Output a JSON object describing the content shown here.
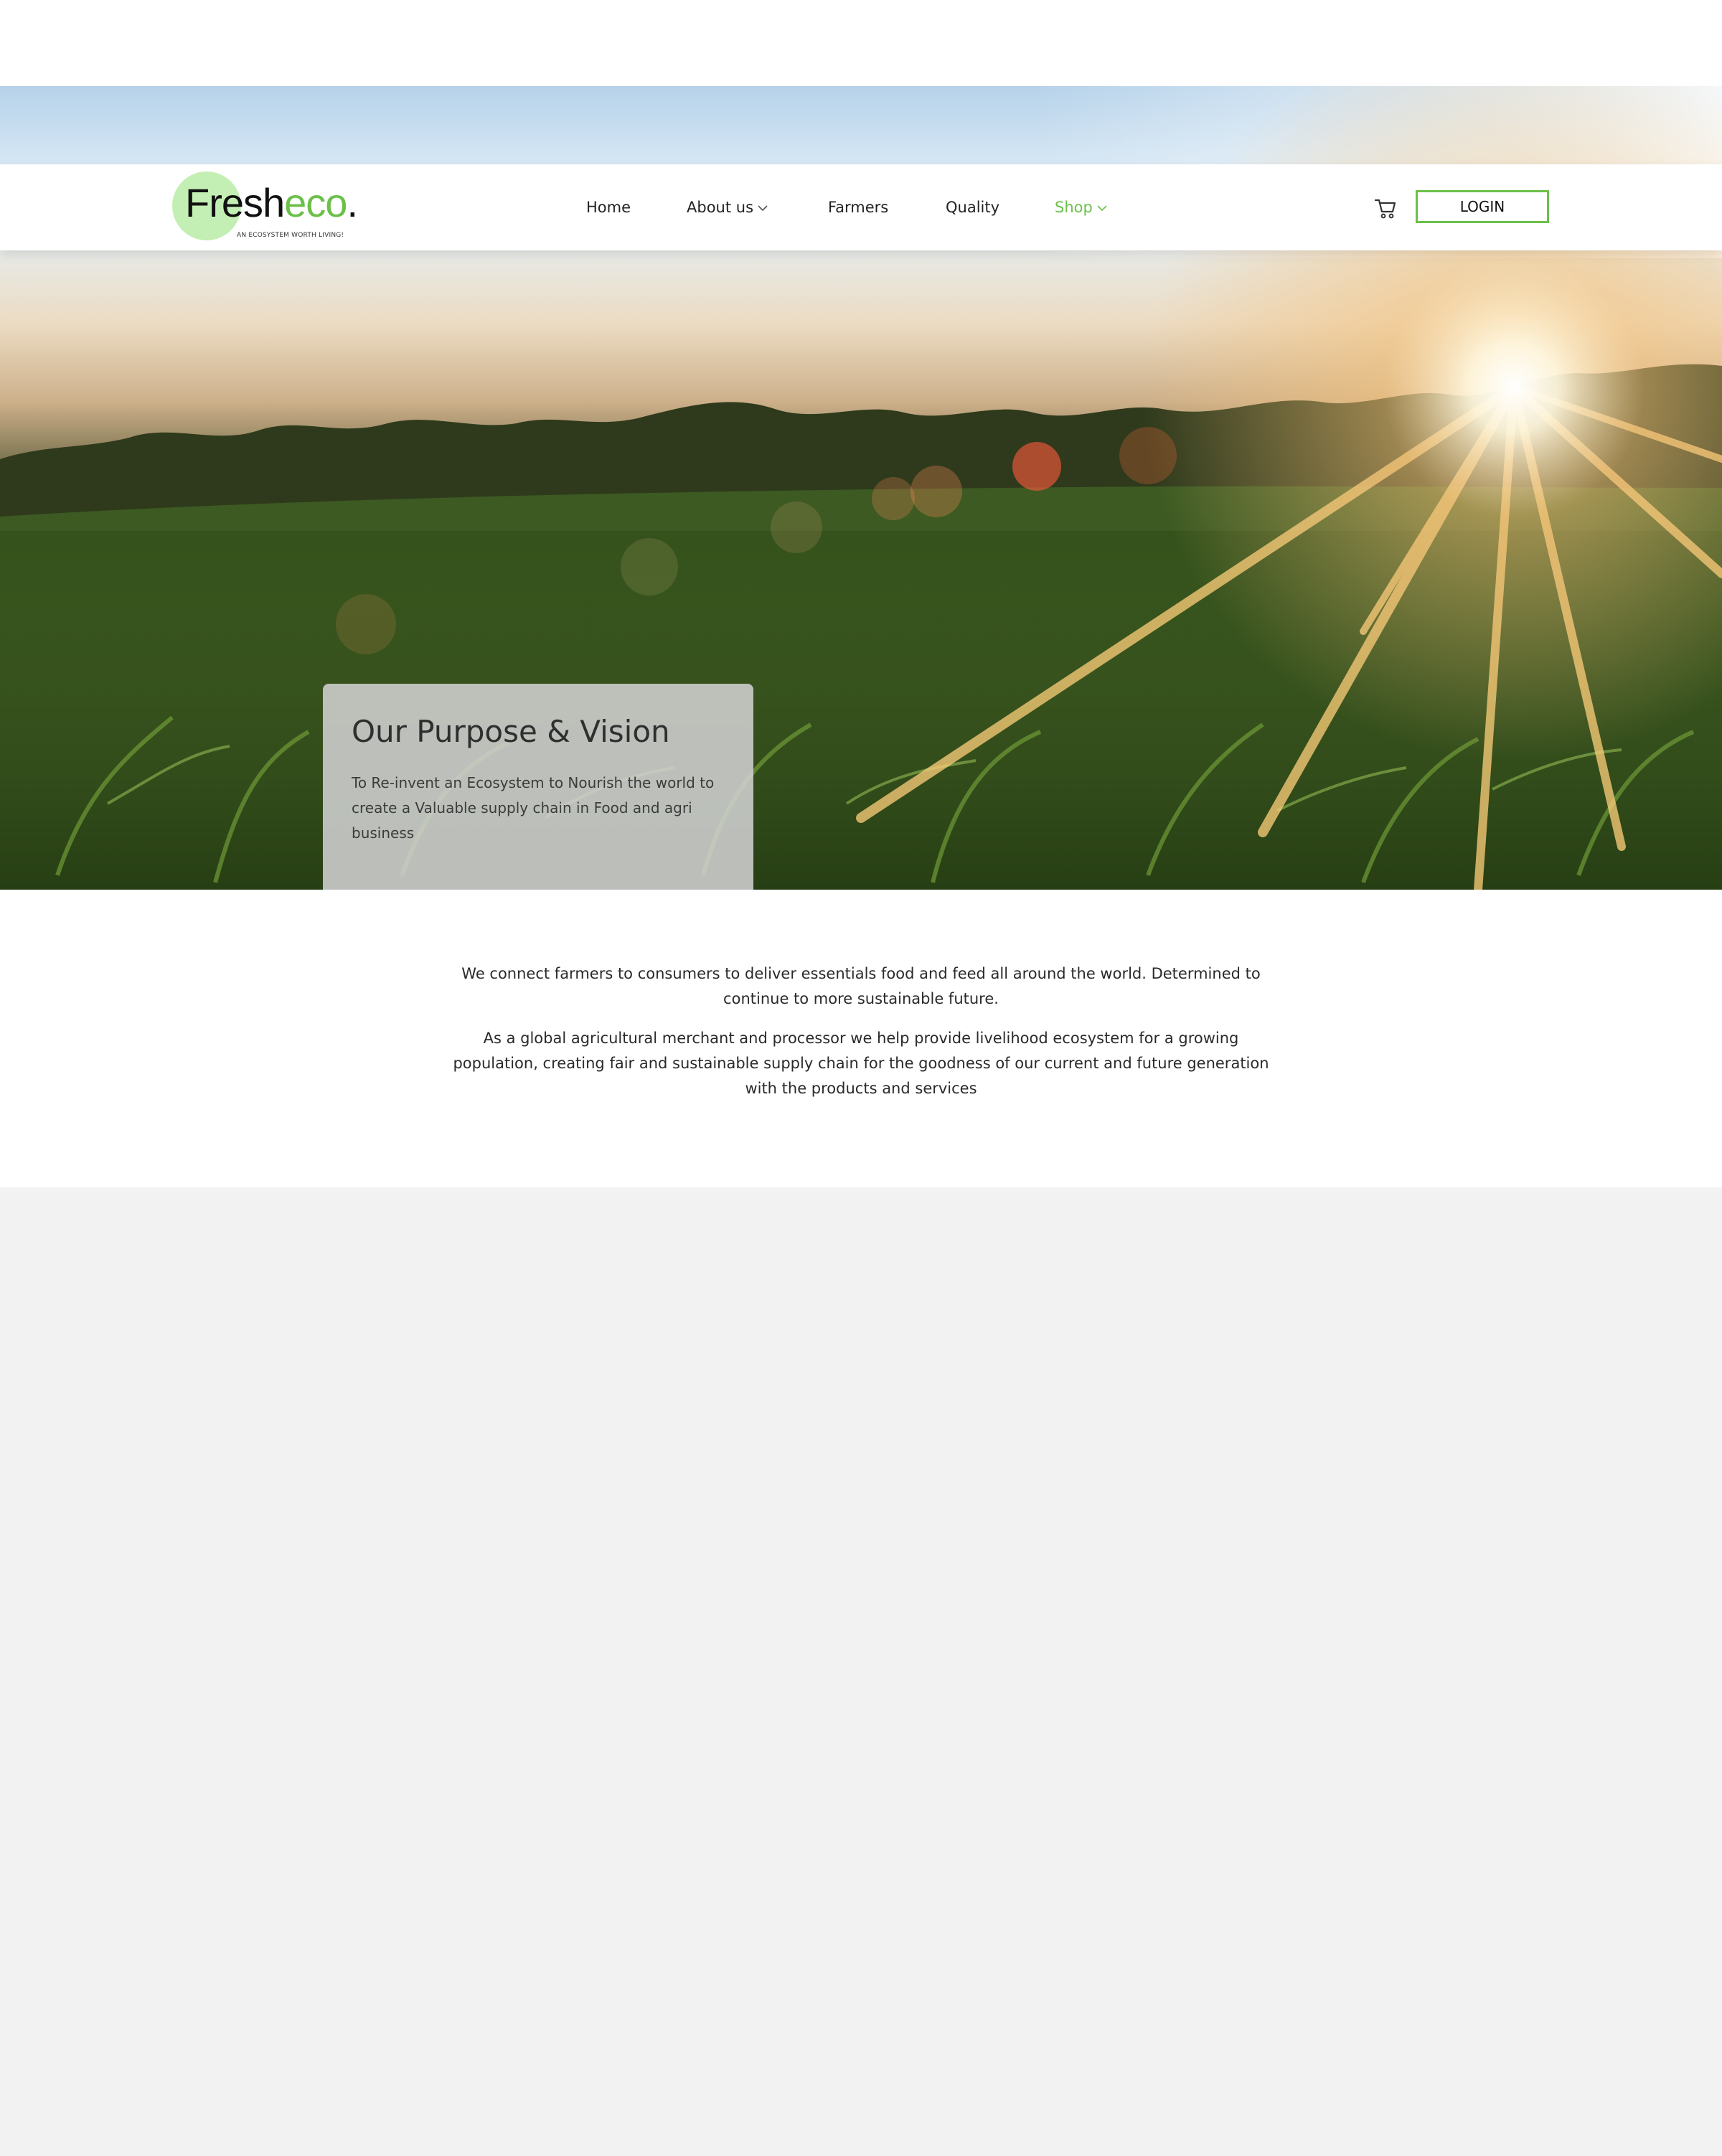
{
  "brand": {
    "name_dark": "Fresh",
    "name_green": "eco",
    "name_dot": ".",
    "tagline": "AN ECOSYSTEM WORTH LIVING!"
  },
  "nav": {
    "items": [
      {
        "label": "Home"
      },
      {
        "label": "About us",
        "has_dropdown": true
      },
      {
        "label": "Farmers"
      },
      {
        "label": "Quality"
      },
      {
        "label": "Shop",
        "has_dropdown": true,
        "active": true
      }
    ]
  },
  "header": {
    "cart_icon": "cart-icon",
    "login_label": "LOGIN"
  },
  "hero": {
    "card_title": "Our Purpose & Vision",
    "card_text": "To Re-invent an Ecosystem to Nourish the world to create a Valuable supply chain in Food and agri business"
  },
  "info": {
    "paragraph_1": "We connect farmers to consumers to deliver essentials food and feed all around the world. Determined to continue to more sustainable future.",
    "paragraph_2": "As a global agricultural merchant and processor we help provide livelihood ecosystem for a growing population, creating fair and sustainable supply chain for the goodness of our current and future generation with the products and services"
  },
  "colors": {
    "accent": "#6cc04a",
    "logo_circle": "#c4efb4",
    "page_bg": "#f2f2f2",
    "text": "#2b2b2b"
  }
}
